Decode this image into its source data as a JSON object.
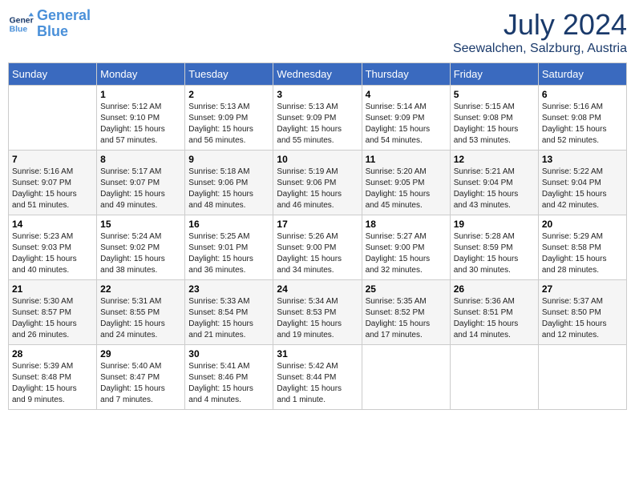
{
  "header": {
    "logo_line1": "General",
    "logo_line2": "Blue",
    "month_year": "July 2024",
    "location": "Seewalchen, Salzburg, Austria"
  },
  "days_of_week": [
    "Sunday",
    "Monday",
    "Tuesday",
    "Wednesday",
    "Thursday",
    "Friday",
    "Saturday"
  ],
  "weeks": [
    [
      {
        "day": "",
        "info": ""
      },
      {
        "day": "1",
        "info": "Sunrise: 5:12 AM\nSunset: 9:10 PM\nDaylight: 15 hours\nand 57 minutes."
      },
      {
        "day": "2",
        "info": "Sunrise: 5:13 AM\nSunset: 9:09 PM\nDaylight: 15 hours\nand 56 minutes."
      },
      {
        "day": "3",
        "info": "Sunrise: 5:13 AM\nSunset: 9:09 PM\nDaylight: 15 hours\nand 55 minutes."
      },
      {
        "day": "4",
        "info": "Sunrise: 5:14 AM\nSunset: 9:09 PM\nDaylight: 15 hours\nand 54 minutes."
      },
      {
        "day": "5",
        "info": "Sunrise: 5:15 AM\nSunset: 9:08 PM\nDaylight: 15 hours\nand 53 minutes."
      },
      {
        "day": "6",
        "info": "Sunrise: 5:16 AM\nSunset: 9:08 PM\nDaylight: 15 hours\nand 52 minutes."
      }
    ],
    [
      {
        "day": "7",
        "info": "Sunrise: 5:16 AM\nSunset: 9:07 PM\nDaylight: 15 hours\nand 51 minutes."
      },
      {
        "day": "8",
        "info": "Sunrise: 5:17 AM\nSunset: 9:07 PM\nDaylight: 15 hours\nand 49 minutes."
      },
      {
        "day": "9",
        "info": "Sunrise: 5:18 AM\nSunset: 9:06 PM\nDaylight: 15 hours\nand 48 minutes."
      },
      {
        "day": "10",
        "info": "Sunrise: 5:19 AM\nSunset: 9:06 PM\nDaylight: 15 hours\nand 46 minutes."
      },
      {
        "day": "11",
        "info": "Sunrise: 5:20 AM\nSunset: 9:05 PM\nDaylight: 15 hours\nand 45 minutes."
      },
      {
        "day": "12",
        "info": "Sunrise: 5:21 AM\nSunset: 9:04 PM\nDaylight: 15 hours\nand 43 minutes."
      },
      {
        "day": "13",
        "info": "Sunrise: 5:22 AM\nSunset: 9:04 PM\nDaylight: 15 hours\nand 42 minutes."
      }
    ],
    [
      {
        "day": "14",
        "info": "Sunrise: 5:23 AM\nSunset: 9:03 PM\nDaylight: 15 hours\nand 40 minutes."
      },
      {
        "day": "15",
        "info": "Sunrise: 5:24 AM\nSunset: 9:02 PM\nDaylight: 15 hours\nand 38 minutes."
      },
      {
        "day": "16",
        "info": "Sunrise: 5:25 AM\nSunset: 9:01 PM\nDaylight: 15 hours\nand 36 minutes."
      },
      {
        "day": "17",
        "info": "Sunrise: 5:26 AM\nSunset: 9:00 PM\nDaylight: 15 hours\nand 34 minutes."
      },
      {
        "day": "18",
        "info": "Sunrise: 5:27 AM\nSunset: 9:00 PM\nDaylight: 15 hours\nand 32 minutes."
      },
      {
        "day": "19",
        "info": "Sunrise: 5:28 AM\nSunset: 8:59 PM\nDaylight: 15 hours\nand 30 minutes."
      },
      {
        "day": "20",
        "info": "Sunrise: 5:29 AM\nSunset: 8:58 PM\nDaylight: 15 hours\nand 28 minutes."
      }
    ],
    [
      {
        "day": "21",
        "info": "Sunrise: 5:30 AM\nSunset: 8:57 PM\nDaylight: 15 hours\nand 26 minutes."
      },
      {
        "day": "22",
        "info": "Sunrise: 5:31 AM\nSunset: 8:55 PM\nDaylight: 15 hours\nand 24 minutes."
      },
      {
        "day": "23",
        "info": "Sunrise: 5:33 AM\nSunset: 8:54 PM\nDaylight: 15 hours\nand 21 minutes."
      },
      {
        "day": "24",
        "info": "Sunrise: 5:34 AM\nSunset: 8:53 PM\nDaylight: 15 hours\nand 19 minutes."
      },
      {
        "day": "25",
        "info": "Sunrise: 5:35 AM\nSunset: 8:52 PM\nDaylight: 15 hours\nand 17 minutes."
      },
      {
        "day": "26",
        "info": "Sunrise: 5:36 AM\nSunset: 8:51 PM\nDaylight: 15 hours\nand 14 minutes."
      },
      {
        "day": "27",
        "info": "Sunrise: 5:37 AM\nSunset: 8:50 PM\nDaylight: 15 hours\nand 12 minutes."
      }
    ],
    [
      {
        "day": "28",
        "info": "Sunrise: 5:39 AM\nSunset: 8:48 PM\nDaylight: 15 hours\nand 9 minutes."
      },
      {
        "day": "29",
        "info": "Sunrise: 5:40 AM\nSunset: 8:47 PM\nDaylight: 15 hours\nand 7 minutes."
      },
      {
        "day": "30",
        "info": "Sunrise: 5:41 AM\nSunset: 8:46 PM\nDaylight: 15 hours\nand 4 minutes."
      },
      {
        "day": "31",
        "info": "Sunrise: 5:42 AM\nSunset: 8:44 PM\nDaylight: 15 hours\nand 1 minute."
      },
      {
        "day": "",
        "info": ""
      },
      {
        "day": "",
        "info": ""
      },
      {
        "day": "",
        "info": ""
      }
    ]
  ]
}
